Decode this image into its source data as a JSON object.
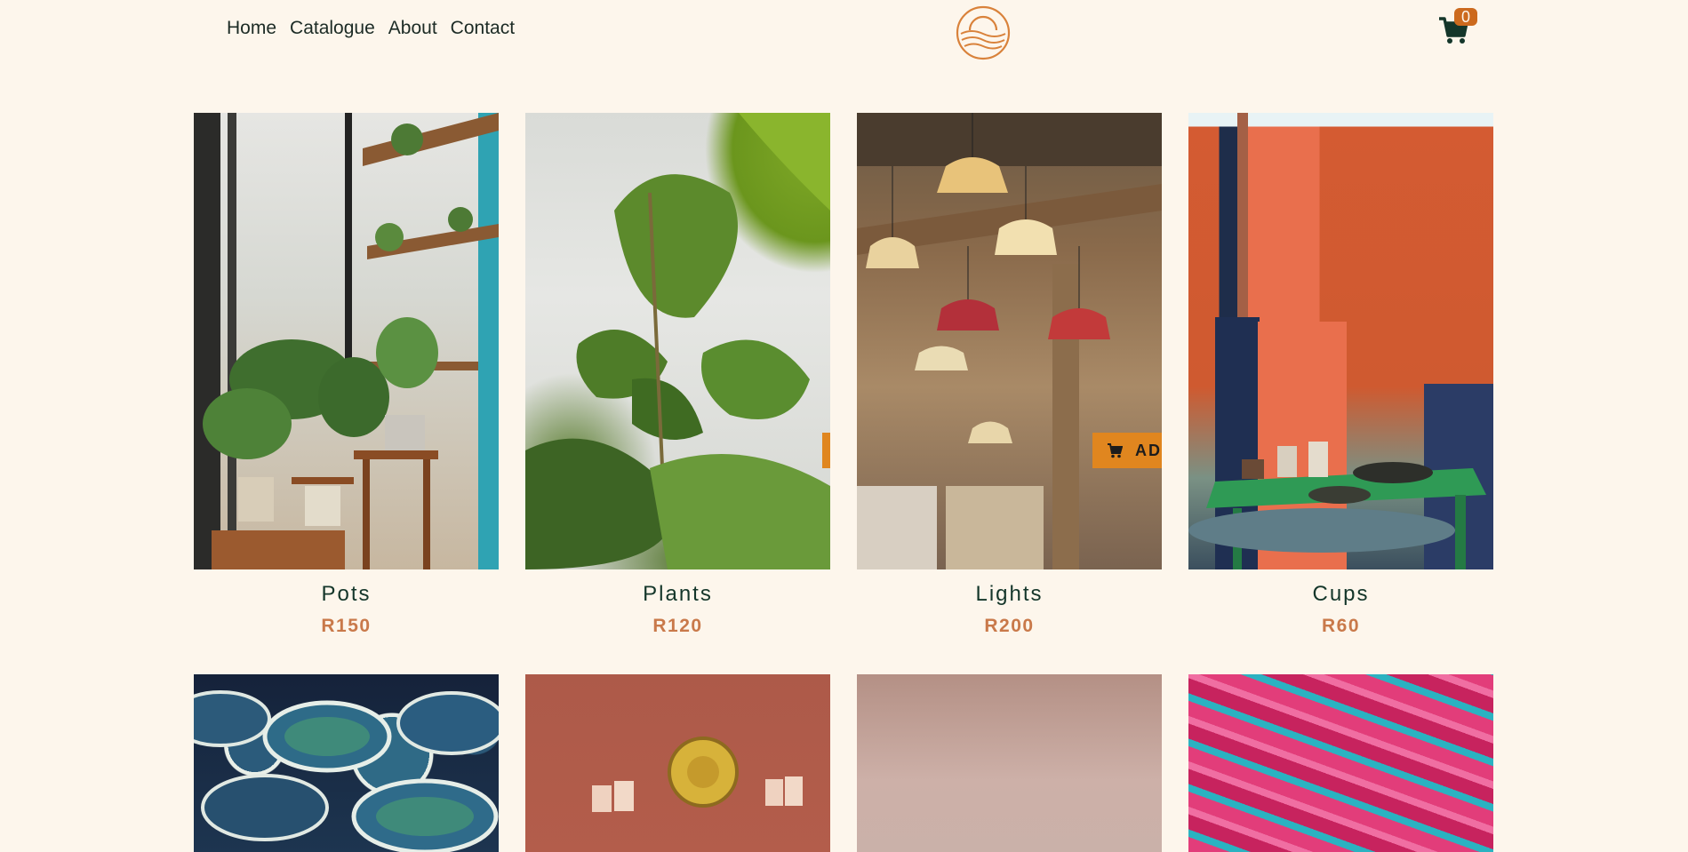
{
  "nav": {
    "links": [
      "Home",
      "Catalogue",
      "About",
      "Contact"
    ]
  },
  "cart": {
    "count": "0",
    "icon": "shopping-cart-icon"
  },
  "logo": {
    "icon": "sun-waves-logo",
    "color": "#d9823b"
  },
  "products": [
    {
      "name": "Pots",
      "price": "R150"
    },
    {
      "name": "Plants",
      "price": "R120"
    },
    {
      "name": "Lights",
      "price": "R200"
    },
    {
      "name": "Cups",
      "price": "R60"
    }
  ],
  "add_button": {
    "label": "AD",
    "icon": "cart-icon"
  },
  "colors": {
    "background": "#fdf6ec",
    "accent": "#e0861f",
    "price": "#c9794a",
    "text": "#14362a"
  }
}
